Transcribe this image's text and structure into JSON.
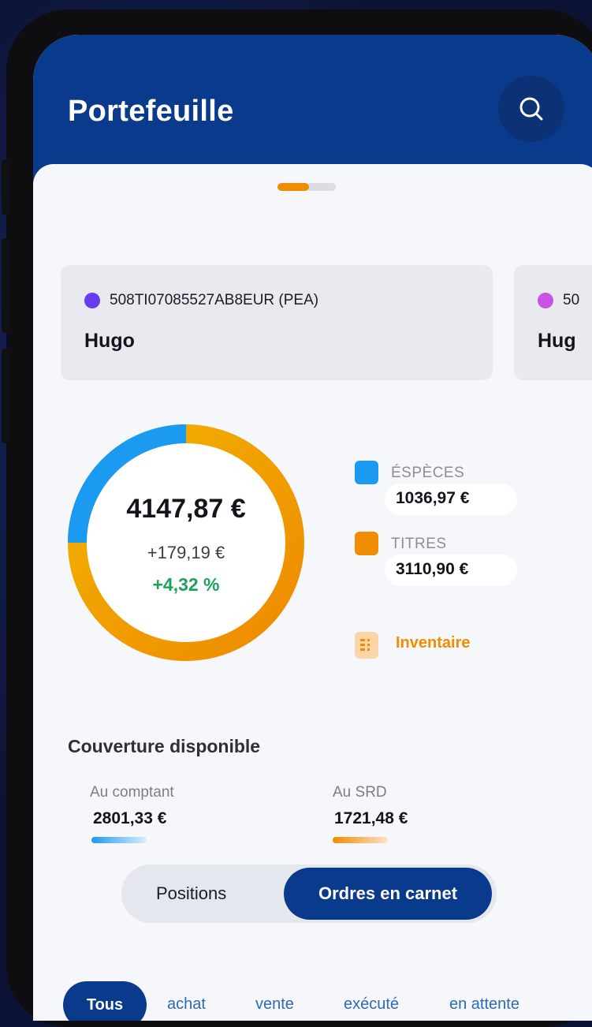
{
  "header": {
    "title": "Portefeuille"
  },
  "accounts": [
    {
      "id": "508TI07085527AB8EUR (PEA)",
      "owner": "Hugo",
      "dot_color": "#6a3cf0"
    },
    {
      "id": "50",
      "owner": "Hug",
      "dot_color": "#c852e6"
    }
  ],
  "portfolio": {
    "total": "4147,87 €",
    "change": "+179,19 €",
    "change_pct": "+4,32 %",
    "legend": [
      {
        "label": "ÉSPÈCES",
        "value": "1036,97 €",
        "color": "#1a9af0"
      },
      {
        "label": "TITRES",
        "value": "3110,90 €",
        "color": "#f08c00"
      }
    ],
    "inventory_label": "Inventaire"
  },
  "coverage": {
    "title": "Couverture disponible",
    "items": [
      {
        "label": "Au comptant",
        "value": "2801,33 €",
        "color": "#1a9af0"
      },
      {
        "label": "Au SRD",
        "value": "1721,48 €",
        "color": "#f08c00"
      }
    ]
  },
  "segmented": {
    "options": [
      "Positions",
      "Ordres en carnet"
    ],
    "selected": "Ordres en carnet"
  },
  "filters": {
    "options": [
      "Tous",
      "achat",
      "vente",
      "exécuté",
      "en attente"
    ],
    "selected": "Tous"
  }
}
